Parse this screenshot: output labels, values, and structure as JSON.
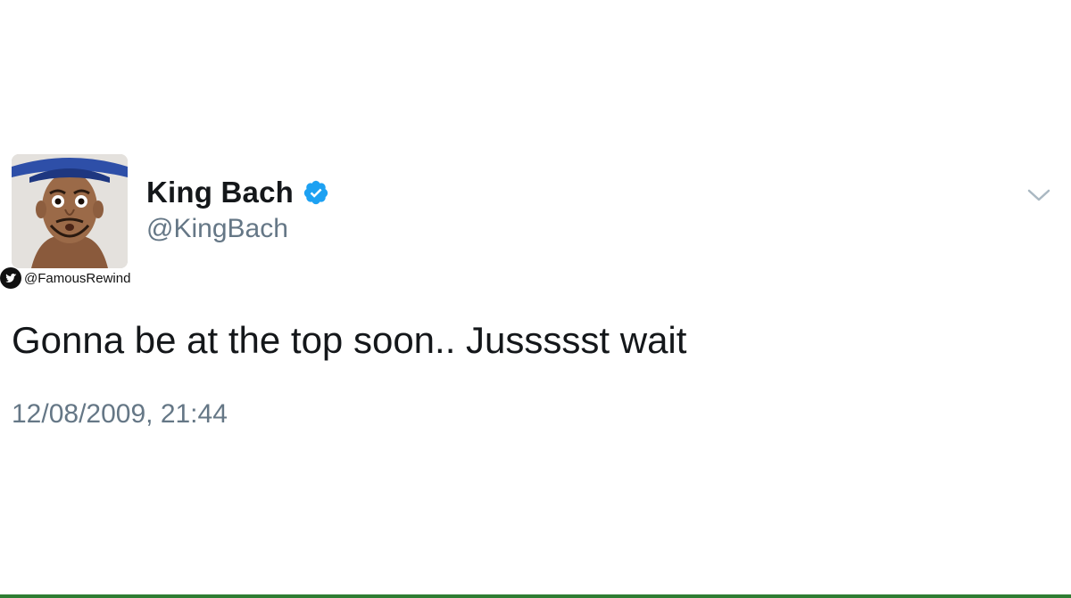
{
  "tweet": {
    "display_name": "King Bach",
    "handle": "@KingBach",
    "text": "Gonna be at the top soon.. Jussssst wait",
    "timestamp": "12/08/2009, 21:44",
    "verified": true
  },
  "watermark": {
    "text": "@FamousRewind",
    "icon": "twitter-bird-icon"
  },
  "icons": {
    "verified": "verified-badge-icon",
    "menu": "chevron-down-icon"
  },
  "colors": {
    "verified_blue": "#1da1f2",
    "secondary_text": "#657786",
    "primary_text": "#14171a",
    "chevron": "#aab8c2"
  }
}
